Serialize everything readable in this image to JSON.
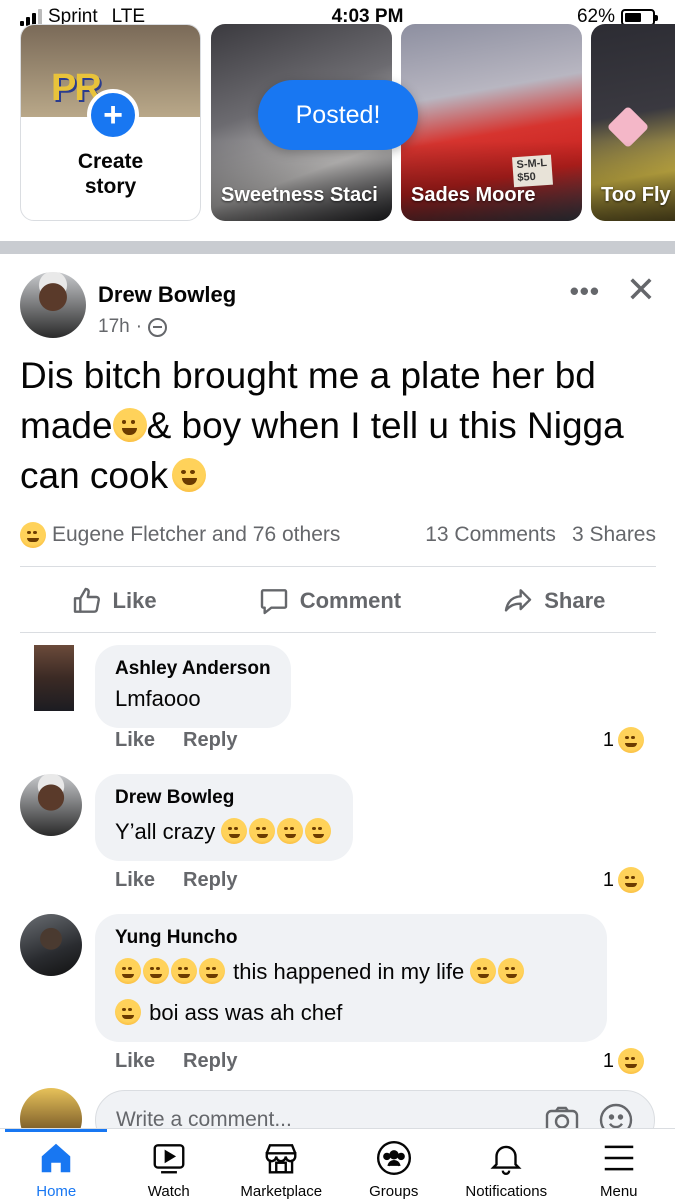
{
  "status_bar": {
    "carrier": "Sprint",
    "network": "LTE",
    "time": "4:03 PM",
    "battery": "62%",
    "battery_level": 0.62
  },
  "stories": {
    "create_label_line1": "Create",
    "create_label_line2": "story",
    "items": [
      {
        "name": "Sweetness Staci"
      },
      {
        "name": "Sades Moore",
        "tag_line1": "S-M-L",
        "tag_line2": "$50"
      },
      {
        "name": "Too Fly"
      }
    ]
  },
  "toast": {
    "text": "Posted!"
  },
  "post": {
    "author": "Drew Bowleg",
    "time": "17h",
    "text_part1": "Dis bitch brought me a plate her bd made",
    "text_part2": "& boy when I tell u this Nigga can cook",
    "reactions_text": "Eugene Fletcher and 76 others",
    "comments_count": "13 Comments",
    "shares_count": "3 Shares",
    "actions": {
      "like": "Like",
      "comment": "Comment",
      "share": "Share"
    }
  },
  "comments": [
    {
      "name": "Ashley Anderson",
      "text": "Lmfaooo",
      "like": "Like",
      "reply": "Reply",
      "reactions": "1"
    },
    {
      "name": "Drew Bowleg",
      "text": "Y’all crazy",
      "like": "Like",
      "reply": "Reply",
      "reactions": "1"
    },
    {
      "name": "Yung Huncho",
      "text_line1": "this happened in my life",
      "text_line2": "boi ass was ah chef",
      "like": "Like",
      "reply": "Reply",
      "reactions": "1"
    }
  ],
  "write_comment": {
    "placeholder": "Write a comment..."
  },
  "bottom_nav": {
    "items": [
      {
        "label": "Home",
        "icon": "home-icon"
      },
      {
        "label": "Watch",
        "icon": "watch-icon"
      },
      {
        "label": "Marketplace",
        "icon": "marketplace-icon"
      },
      {
        "label": "Groups",
        "icon": "groups-icon"
      },
      {
        "label": "Notifications",
        "icon": "bell-icon"
      },
      {
        "label": "Menu",
        "icon": "menu-icon"
      }
    ]
  },
  "colors": {
    "accent": "#1877f2",
    "text_secondary": "#65676b",
    "bubble": "#f0f2f5"
  }
}
